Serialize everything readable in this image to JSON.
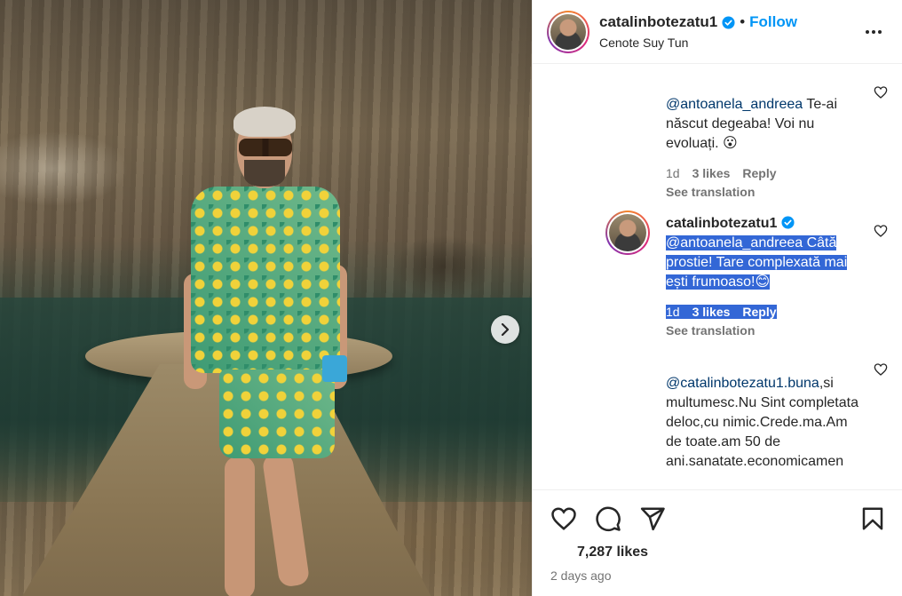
{
  "post": {
    "username": "catalinbotezatu1",
    "separator": "•",
    "follow_label": "Follow",
    "location": "Cenote Suy Tun"
  },
  "comments": [
    {
      "mention": "@antoanela_andreea",
      "text": " Te-ai născut degeaba! Voi nu evoluați. 😮",
      "time": "1d",
      "likes": "3 likes",
      "reply": "Reply",
      "see_translation": "See translation"
    },
    {
      "username": "catalinbotezatu1",
      "mention": "@antoanela_andreea",
      "text": " Câtă prostie! Tare complexată mai ești frumoaso!😊",
      "time": "1d",
      "likes": "3 likes",
      "reply": "Reply",
      "see_translation": "See translation"
    },
    {
      "mention": "@catalinbotezatu1.buna",
      "text": ",si multumesc.Nu Sint completata deloc,cu nimic.Crede.ma.Am de toate.am 50 de ani.sanatate.economicamen"
    }
  ],
  "footer": {
    "likes": "7,287 likes",
    "time": "2 days ago"
  },
  "colors": {
    "accent": "#0095f6",
    "selection": "#3367d6",
    "verified": "#0095f6"
  }
}
